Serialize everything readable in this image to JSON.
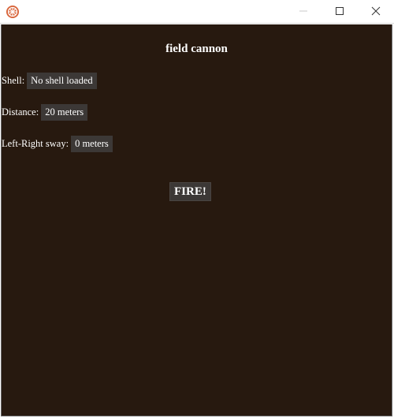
{
  "window": {
    "title_icon": "app-icon",
    "controls": {
      "minimize_icon": "minimize-icon",
      "maximize_icon": "maximize-icon",
      "close_icon": "close-icon"
    }
  },
  "app": {
    "title": "field cannon",
    "shell": {
      "label": "Shell:",
      "value": "No shell loaded"
    },
    "distance": {
      "label": "Distance:",
      "value": "20 meters"
    },
    "sway": {
      "label": "Left-Right sway:",
      "value": "0 meters"
    },
    "fire_label": "FIRE!"
  },
  "colors": {
    "background": "#27190f",
    "field_background": "#3c3836",
    "text": "#ffffff",
    "icon_accent": "#d8643a"
  }
}
